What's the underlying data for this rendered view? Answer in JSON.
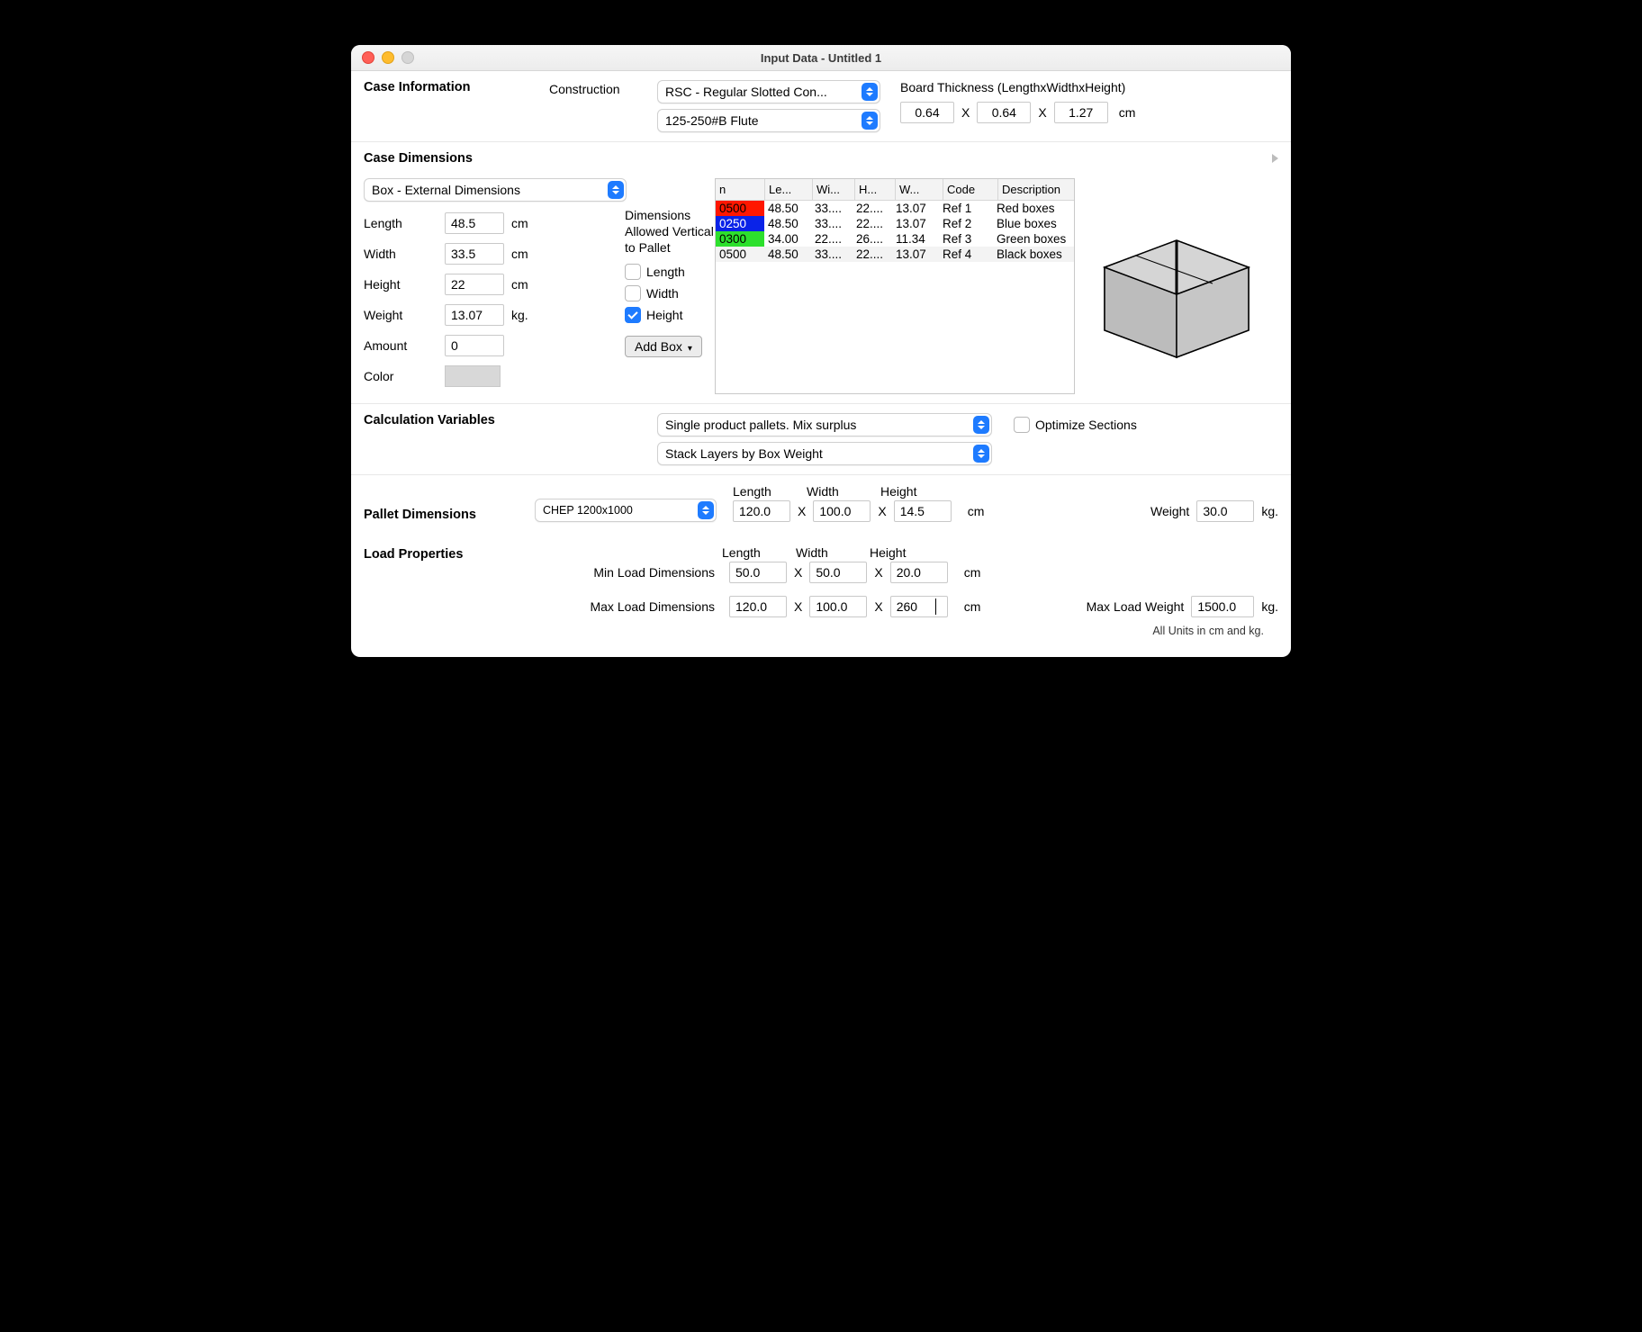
{
  "window_title": "Input Data - Untitled 1",
  "case_info": {
    "heading": "Case Information",
    "construction_label": "Construction",
    "construction_select": "RSC - Regular Slotted Con...",
    "flute_select": "125-250#B Flute",
    "board_thickness_label": "Board Thickness (LengthxWidthxHeight)",
    "thickness_L": "0.64",
    "thickness_W": "0.64",
    "thickness_H": "1.27",
    "thickness_unit": "cm",
    "x": "X"
  },
  "case_dims": {
    "heading": "Case Dimensions",
    "mode_select": "Box - External Dimensions",
    "length_label": "Length",
    "length_val": "48.5",
    "length_unit": "cm",
    "width_label": "Width",
    "width_val": "33.5",
    "width_unit": "cm",
    "height_label": "Height",
    "height_val": "22",
    "height_unit": "cm",
    "weight_label": "Weight",
    "weight_val": "13.07",
    "weight_unit": "kg.",
    "amount_label": "Amount",
    "amount_val": "0",
    "color_label": "Color",
    "dims_allowed_label": "Dimensions Allowed Vertical to Pallet",
    "chk_length": "Length",
    "chk_width": "Width",
    "chk_height": "Height",
    "add_box": "Add Box",
    "table": {
      "headers": {
        "n": "n",
        "l": "Le...",
        "w": "Wi...",
        "h": "H...",
        "we": "W...",
        "code": "Code",
        "desc": "Description"
      },
      "rows": [
        {
          "n": "0500",
          "n_bg": "#ff1700",
          "n_fg": "#000",
          "l": "48.50",
          "w": "33....",
          "h": "22....",
          "we": "13.07",
          "code": "Ref 1",
          "desc": "Red boxes"
        },
        {
          "n": "0250",
          "n_bg": "#0a23e8",
          "n_fg": "#fff",
          "l": "48.50",
          "w": "33....",
          "h": "22....",
          "we": "13.07",
          "code": "Ref 2",
          "desc": "Blue boxes"
        },
        {
          "n": "0300",
          "n_bg": "#2de02d",
          "n_fg": "#000",
          "l": "34.00",
          "w": "22....",
          "h": "26....",
          "we": "11.34",
          "code": "Ref 3",
          "desc": "Green boxes"
        },
        {
          "n": "0500",
          "n_bg": "",
          "n_fg": "#000",
          "l": "48.50",
          "w": "33....",
          "h": "22....",
          "we": "13.07",
          "code": "Ref 4",
          "desc": "Black boxes"
        }
      ]
    }
  },
  "calc": {
    "heading": "Calculation Variables",
    "mode_select": "Single product pallets. Mix surplus",
    "stack_select": "Stack Layers by Box Weight",
    "optimize_label": "Optimize Sections"
  },
  "pallet": {
    "heading": "Pallet Dimensions",
    "type_select": "CHEP 1200x1000",
    "length_label": "Length",
    "length_val": "120.0",
    "width_label": "Width",
    "width_val": "100.0",
    "height_label": "Height",
    "height_val": "14.5",
    "unit": "cm",
    "weight_label": "Weight",
    "weight_val": "30.0",
    "weight_unit": "kg.",
    "x": "X"
  },
  "load": {
    "heading": "Load Properties",
    "min_label": "Min Load Dimensions",
    "max_label": "Max Load Dimensions",
    "length_label": "Length",
    "width_label": "Width",
    "height_label": "Height",
    "min_L": "50.0",
    "min_W": "50.0",
    "min_H": "20.0",
    "max_L": "120.0",
    "max_W": "100.0",
    "max_H": "260",
    "unit": "cm",
    "max_weight_label": "Max Load Weight",
    "max_weight_val": "1500.0",
    "max_weight_unit": "kg.",
    "x": "X"
  },
  "footer": "All Units in cm and kg."
}
